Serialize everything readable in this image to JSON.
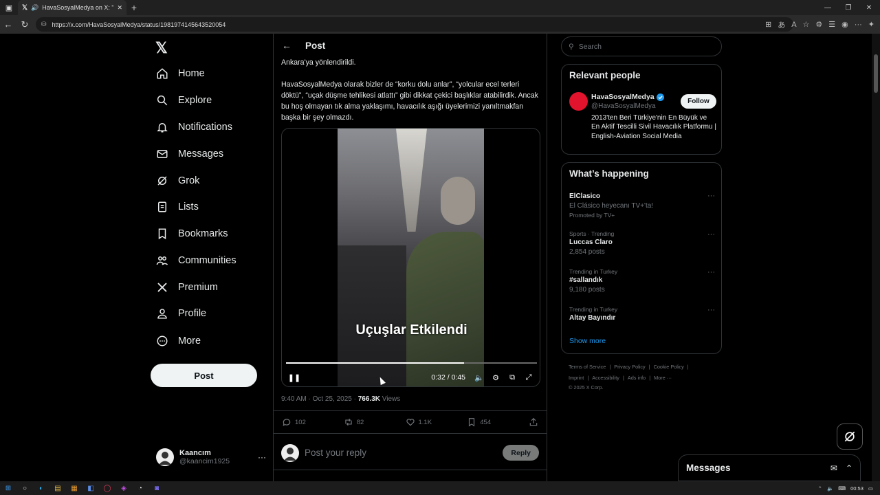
{
  "browser": {
    "tab_title": "HavaSosyalMedya on X: \"Ol...",
    "url": "https://x.com/HavaSosyalMedya/status/1981974145643520054"
  },
  "nav": {
    "items": [
      {
        "label": "Home",
        "icon": "home-icon"
      },
      {
        "label": "Explore",
        "icon": "search-icon"
      },
      {
        "label": "Notifications",
        "icon": "bell-icon"
      },
      {
        "label": "Messages",
        "icon": "envelope-icon"
      },
      {
        "label": "Grok",
        "icon": "grok-icon"
      },
      {
        "label": "Lists",
        "icon": "list-icon"
      },
      {
        "label": "Bookmarks",
        "icon": "bookmark-icon"
      },
      {
        "label": "Communities",
        "icon": "people-icon"
      },
      {
        "label": "Premium",
        "icon": "x-icon"
      },
      {
        "label": "Profile",
        "icon": "person-icon"
      },
      {
        "label": "More",
        "icon": "more-circle-icon"
      }
    ],
    "post_label": "Post",
    "user": {
      "name": "Kaancım",
      "handle": "@kaancim1925"
    }
  },
  "post": {
    "header": "Post",
    "text_1": "Ankara'ya yönlendirildi.",
    "text_2": "HavaSosyalMedya olarak bizler de “korku dolu anlar”, “yolcular ecel terleri döktü”, “uçak düşme tehlikesi atlattı” gibi dikkat çekici başlıklar atabilirdik. Ancak bu hoş olmayan tık alma yaklaşımı, havacılık aşığı üyelerimizi yanıltmakfan başka bir şey olmazdı.",
    "video": {
      "caption": "Uçuşlar Etkilendi",
      "time": "0:32 / 0:45",
      "progress": 0.71
    },
    "timestamp": "9:40 AM · Oct 25, 2025 · ",
    "views_count": "766.3K",
    "views_label": " Views",
    "replies": "102",
    "reposts": "82",
    "likes": "1.1K",
    "bookmarks": "454",
    "reply_placeholder": "Post your reply",
    "reply_button": "Reply"
  },
  "right": {
    "search_placeholder": "Search",
    "relevant_title": "Relevant people",
    "person": {
      "name": "HavaSosyalMedya",
      "handle": "@HavaSosyalMedya",
      "bio": "2013'ten Beri Türkiye'nin En Büyük ve En Aktif Tescilli Sivil Havacılık Platformu | English-Aviation Social Media",
      "follow": "Follow"
    },
    "happening_title": "What’s happening",
    "trends": [
      {
        "context": "",
        "title": "ElClasico",
        "sub": "El Clásico heyecanı TV+'ta!",
        "sub2": "Promoted by TV+"
      },
      {
        "context": "Sports · Trending",
        "title": "Luccas Claro",
        "sub": "2,854 posts",
        "sub2": ""
      },
      {
        "context": "Trending in Turkey",
        "title": "#sallandık",
        "sub": "9,180 posts",
        "sub2": ""
      },
      {
        "context": "Trending in Turkey",
        "title": "Altay Bayındır",
        "sub": "",
        "sub2": ""
      }
    ],
    "show_more": "Show more",
    "footer_1": [
      "Terms of Service",
      "|",
      "Privacy Policy",
      "|",
      "Cookie Policy",
      "|"
    ],
    "footer_2": [
      "Imprint",
      "|",
      "Accessibility",
      "|",
      "Ads info",
      "|",
      "More ···"
    ],
    "footer_3": "© 2025 X Corp."
  },
  "messages_bar": {
    "title": "Messages"
  },
  "taskbar": {
    "time": "00:53"
  },
  "colors": {
    "accent": "#1d9bf0",
    "bg": "#000000",
    "border": "#2f3336",
    "muted": "#71767b"
  }
}
